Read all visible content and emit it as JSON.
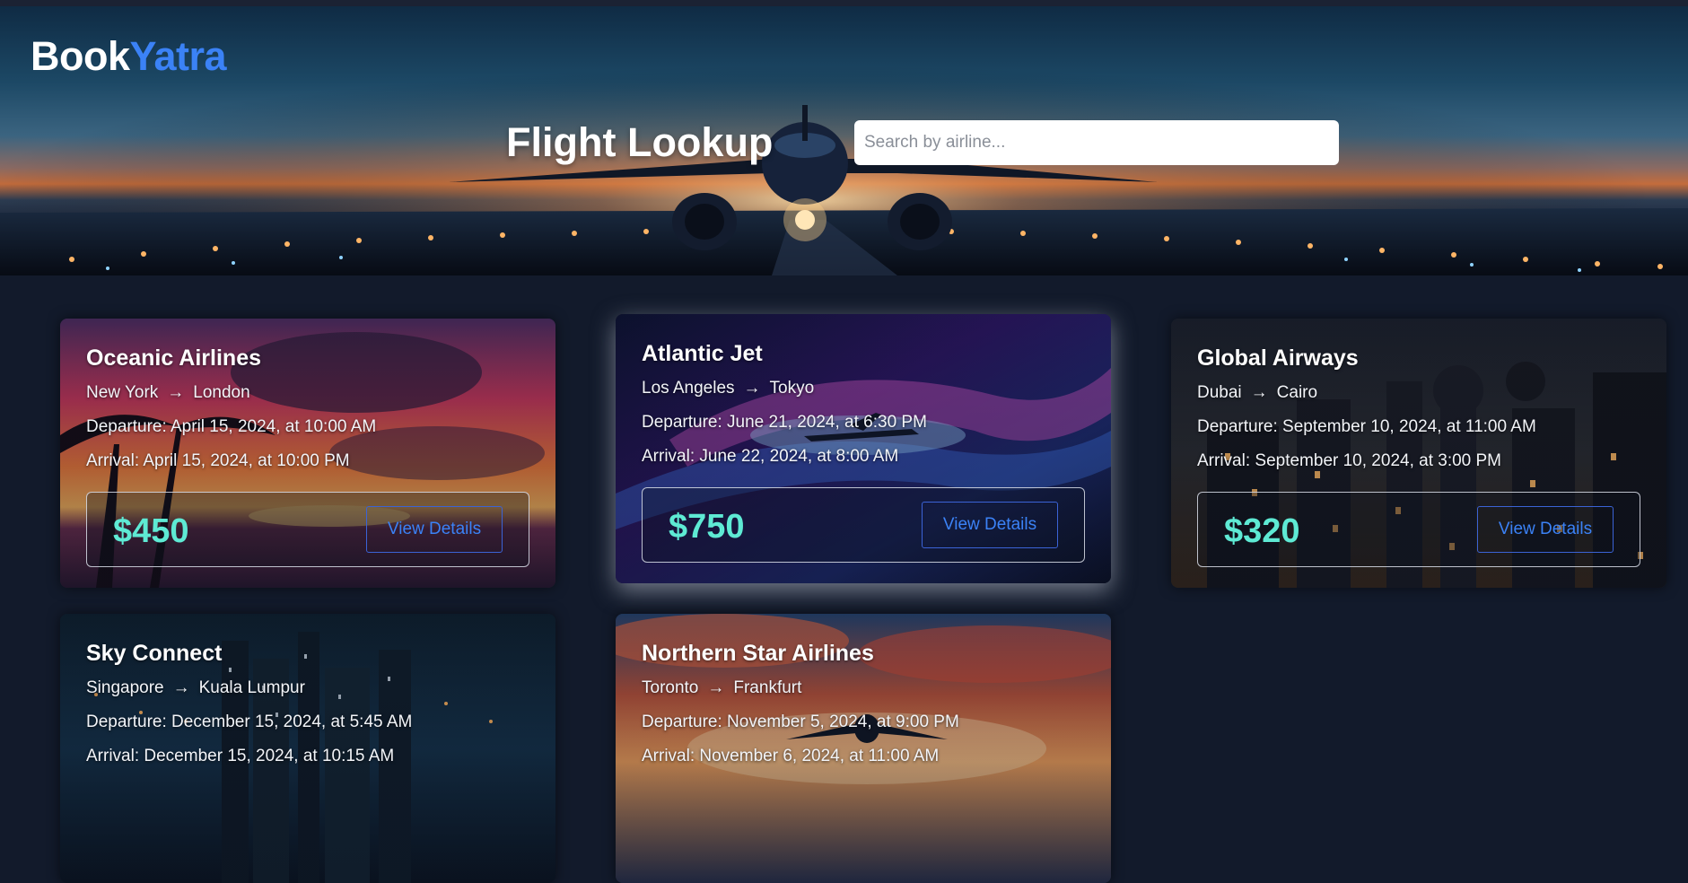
{
  "brand": {
    "part1": "Book",
    "part2": "Yatra"
  },
  "hero": {
    "title": "Flight Lookup",
    "search_placeholder": "Search by airline..."
  },
  "colors": {
    "accent": "#3b82f6",
    "price": "#5eead4",
    "background": "#121a2b"
  },
  "flights": [
    {
      "airline": "Oceanic Airlines",
      "from": "New York",
      "arrow": "→",
      "to": "London",
      "departure": "Departure: April 15, 2024, at 10:00 AM",
      "arrival": "Arrival: April 15, 2024, at 10:00 PM",
      "price": "$450",
      "button": "View Details"
    },
    {
      "airline": "Atlantic Jet",
      "from": "Los Angeles",
      "arrow": "→",
      "to": "Tokyo",
      "departure": "Departure: June 21, 2024, at 6:30 PM",
      "arrival": "Arrival: June 22, 2024, at 8:00 AM",
      "price": "$750",
      "button": "View Details"
    },
    {
      "airline": "Global Airways",
      "from": "Dubai",
      "arrow": "→",
      "to": "Cairo",
      "departure": "Departure: September 10, 2024, at 11:00 AM",
      "arrival": "Arrival: September 10, 2024, at 3:00 PM",
      "price": "$320",
      "button": "View Details"
    },
    {
      "airline": "Sky Connect",
      "from": "Singapore",
      "arrow": "→",
      "to": "Kuala Lumpur",
      "departure": "Departure: December 15, 2024, at 5:45 AM",
      "arrival": "Arrival: December 15, 2024, at 10:15 AM"
    },
    {
      "airline": "Northern Star Airlines",
      "from": "Toronto",
      "arrow": "→",
      "to": "Frankfurt",
      "departure": "Departure: November 5, 2024, at 9:00 PM",
      "arrival": "Arrival: November 6, 2024, at 11:00 AM"
    }
  ]
}
